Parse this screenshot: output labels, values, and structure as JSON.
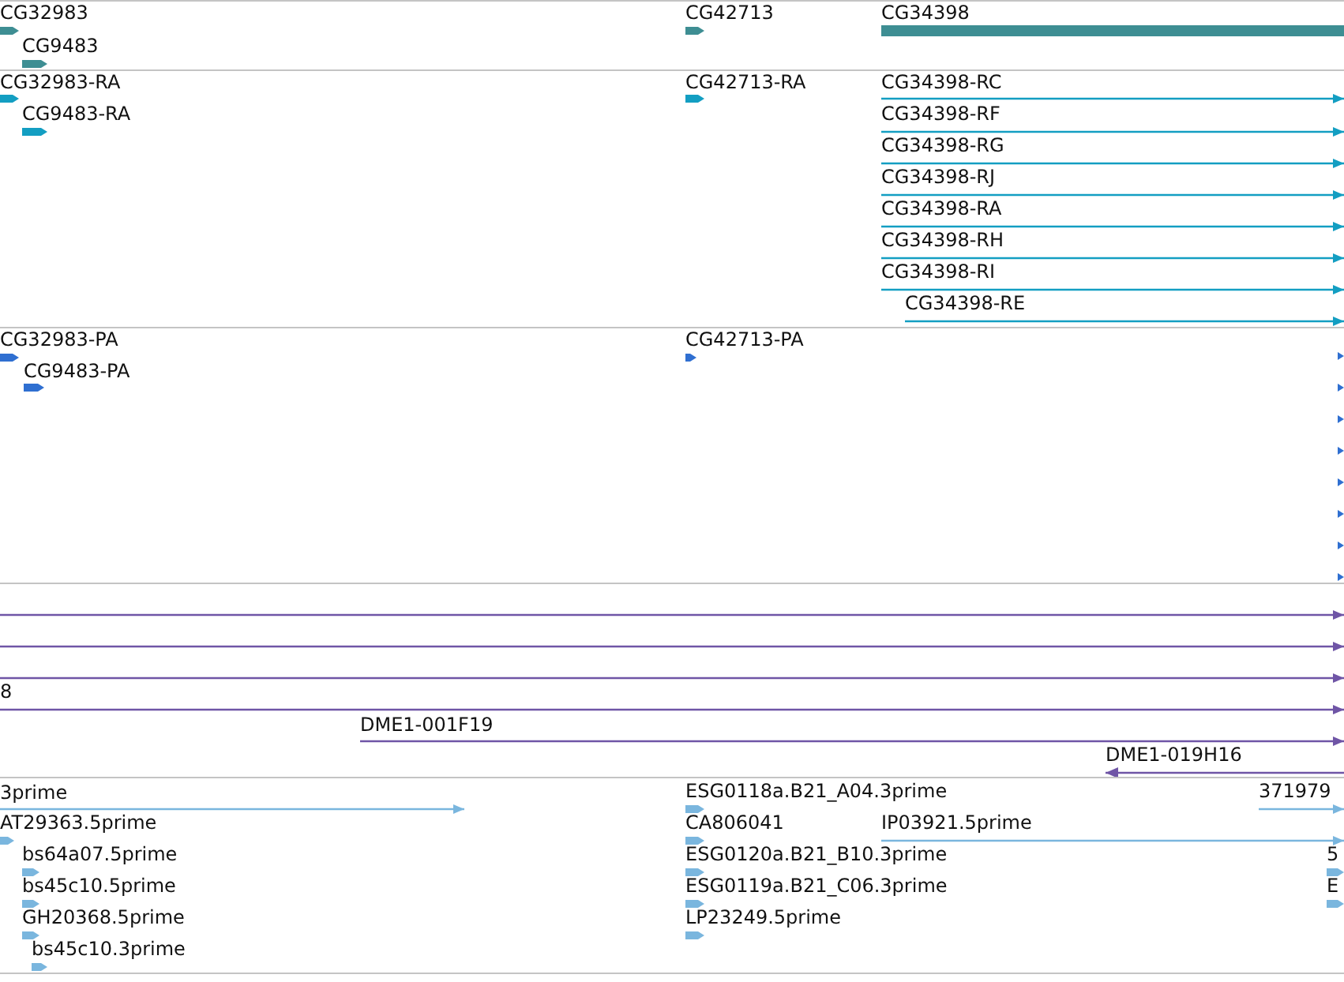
{
  "tracks": [
    {
      "color": "#3e8e93",
      "features": [
        {
          "label": "CG32983",
          "kind": "block",
          "reverse": false
        },
        {
          "label": "CG9483",
          "kind": "block",
          "reverse": false
        },
        {
          "label": "CG42713",
          "kind": "block",
          "reverse": false
        },
        {
          "label": "CG34398",
          "kind": "bar"
        }
      ]
    },
    {
      "color": "#139ec2",
      "features": [
        {
          "label": "CG32983-RA",
          "kind": "block",
          "reverse": false
        },
        {
          "label": "CG9483-RA",
          "kind": "block",
          "reverse": false
        },
        {
          "label": "CG42713-RA",
          "kind": "block",
          "reverse": false
        },
        {
          "label": "CG34398-RC",
          "kind": "line",
          "reverse": false
        },
        {
          "label": "CG34398-RF",
          "kind": "line",
          "reverse": false
        },
        {
          "label": "CG34398-RG",
          "kind": "line",
          "reverse": false
        },
        {
          "label": "CG34398-RJ",
          "kind": "line",
          "reverse": false
        },
        {
          "label": "CG34398-RA",
          "kind": "line",
          "reverse": false
        },
        {
          "label": "CG34398-RH",
          "kind": "line",
          "reverse": false
        },
        {
          "label": "CG34398-RI",
          "kind": "line",
          "reverse": false
        },
        {
          "label": "CG34398-RE",
          "kind": "line",
          "reverse": false
        }
      ]
    },
    {
      "color": "#2f6fd1",
      "features": [
        {
          "label": "CG32983-PA",
          "kind": "block",
          "reverse": false
        },
        {
          "label": "CG9483-PA",
          "kind": "block",
          "reverse": false
        },
        {
          "label": "CG42713-PA",
          "kind": "block",
          "reverse": false
        },
        {
          "kind": "block",
          "reverse": false
        },
        {
          "kind": "block",
          "reverse": false
        },
        {
          "kind": "block",
          "reverse": false
        },
        {
          "kind": "block",
          "reverse": false
        },
        {
          "kind": "block",
          "reverse": false
        },
        {
          "kind": "block",
          "reverse": false
        },
        {
          "kind": "block",
          "reverse": false
        },
        {
          "kind": "block",
          "reverse": false
        }
      ]
    },
    {
      "color": "#6f55a6",
      "features": [
        {
          "kind": "line",
          "reverse": false
        },
        {
          "kind": "line",
          "reverse": false
        },
        {
          "kind": "line",
          "reverse": false
        },
        {
          "label": "8",
          "kind": "line",
          "reverse": false
        },
        {
          "label": "DME1-001F19",
          "kind": "line",
          "reverse": false
        },
        {
          "label": "DME1-019H16",
          "kind": "line",
          "reverse": true
        }
      ]
    },
    {
      "color": "#7ab6de",
      "features": [
        {
          "label": "3prime",
          "kind": "line",
          "reverse": false
        },
        {
          "label": "AT29363.5prime",
          "kind": "block",
          "reverse": false
        },
        {
          "label": "bs64a07.5prime",
          "kind": "block",
          "reverse": false
        },
        {
          "label": "bs45c10.5prime",
          "kind": "block",
          "reverse": false
        },
        {
          "label": "GH20368.5prime",
          "kind": "block",
          "reverse": false
        },
        {
          "label": "bs45c10.3prime",
          "kind": "block",
          "reverse": false
        },
        {
          "label": "ESG0118a.B21_A04.3prime",
          "kind": "block",
          "reverse": false
        },
        {
          "label": "CA806041",
          "kind": "block",
          "reverse": false
        },
        {
          "label": "ESG0120a.B21_B10.3prime",
          "kind": "block",
          "reverse": false
        },
        {
          "label": "ESG0119a.B21_C06.3prime",
          "kind": "block",
          "reverse": false
        },
        {
          "label": "LP23249.5prime",
          "kind": "block",
          "reverse": false
        },
        {
          "label": "371979",
          "kind": "line",
          "reverse": false
        },
        {
          "label": "IP03921.5prime",
          "kind": "line",
          "reverse": false
        },
        {
          "label": "5",
          "kind": "block",
          "reverse": false
        },
        {
          "label": "E",
          "kind": "block",
          "reverse": false
        }
      ]
    }
  ]
}
